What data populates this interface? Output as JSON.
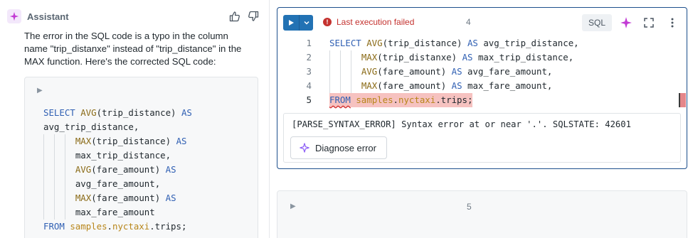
{
  "assistant": {
    "title": "Assistant",
    "icons": {
      "badge": "sparkle-icon",
      "like": "thumbs-up-icon",
      "dislike": "thumbs-down-icon"
    },
    "message_lines": [
      "The error in the SQL code is a typo in the column",
      "name \"trip_distanxe\" instead of \"trip_distance\" in the",
      "MAX function. Here's the corrected SQL code:"
    ],
    "code_block": {
      "run_icon": "play-icon",
      "lines": [
        {
          "indent": 0,
          "tokens": [
            {
              "t": "kw",
              "v": "SELECT "
            },
            {
              "t": "fn",
              "v": "AVG"
            },
            {
              "t": "",
              "v": "(trip_distance) "
            },
            {
              "t": "kw",
              "v": "AS"
            }
          ]
        },
        {
          "indent": 0,
          "tokens": [
            {
              "t": "",
              "v": "avg_trip_distance,"
            }
          ]
        },
        {
          "indent": 3,
          "tokens": [
            {
              "t": "fn",
              "v": "MAX"
            },
            {
              "t": "",
              "v": "(trip_distance) "
            },
            {
              "t": "kw",
              "v": "AS"
            }
          ]
        },
        {
          "indent": 3,
          "tokens": [
            {
              "t": "",
              "v": "max_trip_distance,"
            }
          ]
        },
        {
          "indent": 3,
          "tokens": [
            {
              "t": "fn",
              "v": "AVG"
            },
            {
              "t": "",
              "v": "(fare_amount) "
            },
            {
              "t": "kw",
              "v": "AS"
            }
          ]
        },
        {
          "indent": 3,
          "tokens": [
            {
              "t": "",
              "v": "avg_fare_amount,"
            }
          ]
        },
        {
          "indent": 3,
          "tokens": [
            {
              "t": "fn",
              "v": "MAX"
            },
            {
              "t": "",
              "v": "(fare_amount) "
            },
            {
              "t": "kw",
              "v": "AS"
            }
          ]
        },
        {
          "indent": 3,
          "tokens": [
            {
              "t": "",
              "v": "max_fare_amount"
            }
          ]
        },
        {
          "indent": 0,
          "tokens": [
            {
              "t": "kw",
              "v": "FROM "
            },
            {
              "t": "tb",
              "v": "samples"
            },
            {
              "t": "",
              "v": "."
            },
            {
              "t": "tb",
              "v": "nyctaxi"
            },
            {
              "t": "",
              "v": ".trips;"
            }
          ]
        }
      ]
    }
  },
  "cell4": {
    "number": "4",
    "status_text": "Last execution failed",
    "status_icon": "error-icon",
    "language": "SQL",
    "icons": {
      "run": "play-icon",
      "run_menu": "chevron-down-icon",
      "assistant": "sparkle-icon",
      "expand": "expand-icon",
      "more": "kebab-icon"
    },
    "line_numbers": [
      "1",
      "2",
      "3",
      "4",
      "5"
    ],
    "code_lines": [
      {
        "indent": 0,
        "error": false,
        "tokens": [
          {
            "t": "kw",
            "v": "SELECT "
          },
          {
            "t": "fn",
            "v": "AVG"
          },
          {
            "t": "",
            "v": "(trip_distance) "
          },
          {
            "t": "kw",
            "v": "AS"
          },
          {
            "t": "",
            "v": " avg_trip_distance,"
          }
        ]
      },
      {
        "indent": 3,
        "error": false,
        "tokens": [
          {
            "t": "fn",
            "v": "MAX"
          },
          {
            "t": "",
            "v": "(trip_distanxe) "
          },
          {
            "t": "kw",
            "v": "AS"
          },
          {
            "t": "",
            "v": " max_trip_distance,"
          }
        ]
      },
      {
        "indent": 3,
        "error": false,
        "tokens": [
          {
            "t": "fn",
            "v": "AVG"
          },
          {
            "t": "",
            "v": "(fare_amount) "
          },
          {
            "t": "kw",
            "v": "AS"
          },
          {
            "t": "",
            "v": " avg_fare_amount,"
          }
        ]
      },
      {
        "indent": 3,
        "error": false,
        "tokens": [
          {
            "t": "fn",
            "v": "MAX"
          },
          {
            "t": "",
            "v": "(fare_amount) "
          },
          {
            "t": "kw",
            "v": "AS"
          },
          {
            "t": "",
            "v": " max_fare_amount,"
          }
        ]
      },
      {
        "indent": 0,
        "error": true,
        "tokens": [
          {
            "t": "kw",
            "v": "FROM",
            "sq": true
          },
          {
            "t": "",
            "v": " "
          },
          {
            "t": "tb",
            "v": "samples"
          },
          {
            "t": "",
            "v": "."
          },
          {
            "t": "tb",
            "v": "nyctaxi"
          },
          {
            "t": "",
            "v": ".trips;"
          }
        ]
      }
    ],
    "error_message": "[PARSE_SYNTAX_ERROR] Syntax error at or near '.'. SQLSTATE: 42601",
    "diagnose_label": "Diagnose error",
    "diagnose_icon": "sparkle-icon"
  },
  "cell5": {
    "number": "5",
    "run_icon": "play-icon"
  },
  "colors": {
    "accent": "#2272b4",
    "error": "#c4322f",
    "keyword": "#2f5fb3",
    "function": "#8a6a16",
    "table": "#b8861a",
    "error_line_bg": "#f6c2c0",
    "assistant_sparkle": "#c23bd4"
  }
}
